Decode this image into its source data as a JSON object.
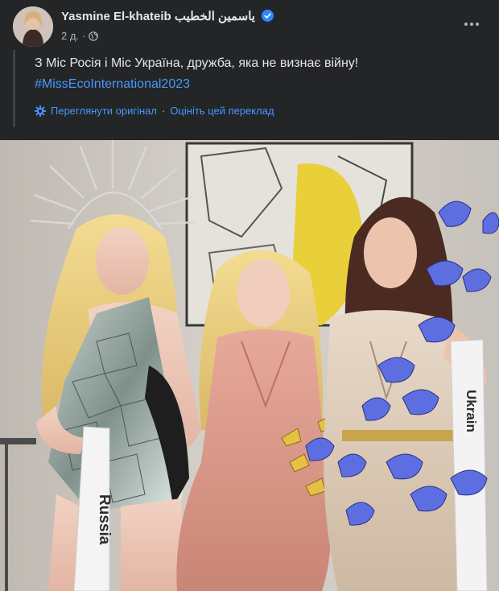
{
  "post": {
    "author": "Yasmine El-khateib ياسمين الخطيب",
    "time": "2 д.",
    "audience_icon": "globe-icon",
    "verified_icon": "verified-badge-icon",
    "text_line1": "З Міс Росія і Міс Україна, дружба, яка не визнає війну!",
    "hashtag": "#MissEcoInternational2023",
    "see_original": "Переглянути оригінал",
    "separator": "·",
    "rate_translation": "Оцініть цей переклад"
  },
  "photo": {
    "sash_left": "Russia",
    "sash_right": "Ukraine",
    "sash_right_partial": "Ukrain"
  },
  "colors": {
    "background": "#242526",
    "text_primary": "#e4e6eb",
    "text_secondary": "#b0b3b8",
    "link": "#4599ff",
    "verified": "#2d88ff"
  }
}
